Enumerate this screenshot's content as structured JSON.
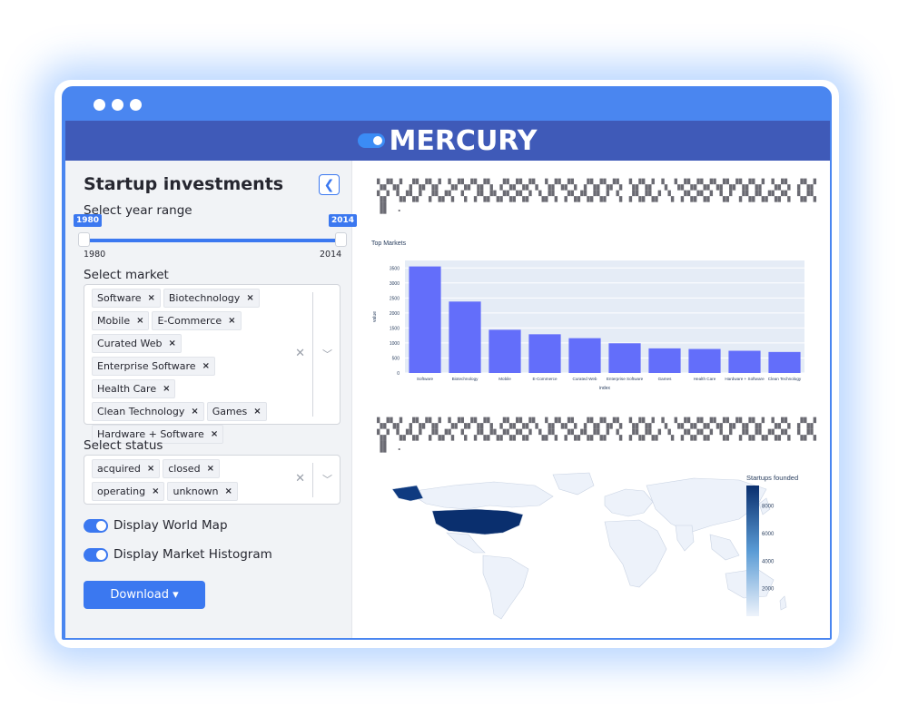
{
  "app": {
    "name": "MERCURY"
  },
  "sidebar": {
    "title": "Startup investments",
    "collapse_icon": "chevron-left-icon",
    "year_range": {
      "label": "Select year range",
      "min": "1980",
      "max": "2014",
      "selected_low": "1980",
      "selected_high": "2014"
    },
    "market": {
      "label": "Select market",
      "selected": [
        "Software",
        "Biotechnology",
        "Mobile",
        "E-Commerce",
        "Curated Web",
        "Enterprise Software",
        "Health Care",
        "Clean Technology",
        "Games",
        "Hardware + Software"
      ],
      "remove_glyph": "×",
      "clear_glyph": "✕",
      "dropdown_icon": "chevron-down-icon"
    },
    "status": {
      "label": "Select status",
      "selected": [
        "acquired",
        "closed",
        "operating",
        "unknown"
      ],
      "remove_glyph": "×",
      "clear_glyph": "✕"
    },
    "toggles": [
      {
        "label": "Display World Map",
        "on": true
      },
      {
        "label": "Display Market Histogram",
        "on": true
      }
    ],
    "download_label": "Download ▾"
  },
  "main": {
    "paragraph_1": "▚▞▚▞ ▞▚▞▚▞ ▚▞▚▞▚▞▚ ▞▚▞▚▞▚ ▚▞▚▞▚ ▞▚▞▚▞▚ ▚▞▚▞ ▚ ▚▞▚▞▚▞▚▞▚▞▚▞▚▞ ▚▞▚ ▞▚▞▚▞ ▚▞▚▞ ▞▚▞▚ ▚ ▞▚▞▚▞▚▞▚▞ ▚▞▚ ▞▚▞▚▞▚▞ ▚ ▞▚▞▚▞ ▚ ▞▚▞▚▞ ▚▞ ▞▚▞▚▞▚▞▚ ▚▞▚ ▐▌ .",
    "paragraph_2": "▚▞▚▞ ▞▚▞▚▞ ▚▞▚▞▚▞▚ ▞▚▞▚▞▚ ▚▞▚▞▚ ▞▚▞▚▞▚ ▚▞▚▞ ▚ ▚▞▚▞▚▞▚▞▚▞▚▞▚▞ ▚▞▚ ▞▚▞▚▞ ▚▞▚▞ ▞▚▞▚ ▚ ▞▚▞▚▞▚▞▚▞ ▚▞▚ ▞▚▞▚▞▚▞ ▚ ▞▚▞▚▞ ▚ ▞▚▞▚▞ ▚▞ ▞▚▞▚▞▚▞▚ ▚▞▚ ▐▌ ."
  },
  "colors": {
    "accent": "#3b78f0",
    "brand_bar": "#3f5ab8",
    "bar_fill": "#636efa",
    "plot_bg": "#e5ecf6"
  },
  "chart_data": [
    {
      "type": "bar",
      "title": "Top Markets",
      "xlabel": "index",
      "ylabel": "value",
      "categories": [
        "Software",
        "Biotechnology",
        "Mobile",
        "E-Commerce",
        "Curated Web",
        "Enterprise Software",
        "Games",
        "Health Care",
        "Hardware + Software",
        "Clean Technology"
      ],
      "values": [
        3550,
        2380,
        1440,
        1290,
        1160,
        990,
        820,
        800,
        740,
        700
      ],
      "yticks": [
        "0",
        "500",
        "1000",
        "1500",
        "2000",
        "2500",
        "3000",
        "3500"
      ],
      "ylim": [
        0,
        3750
      ],
      "grid": true
    },
    {
      "type": "heatmap",
      "subtype": "choropleth",
      "colorbar_title": "Startups founded",
      "colorbar_ticks": [
        "2000",
        "4000",
        "6000",
        "8000"
      ],
      "highlighted": [
        {
          "region": "USA",
          "value": 9500
        }
      ]
    }
  ]
}
